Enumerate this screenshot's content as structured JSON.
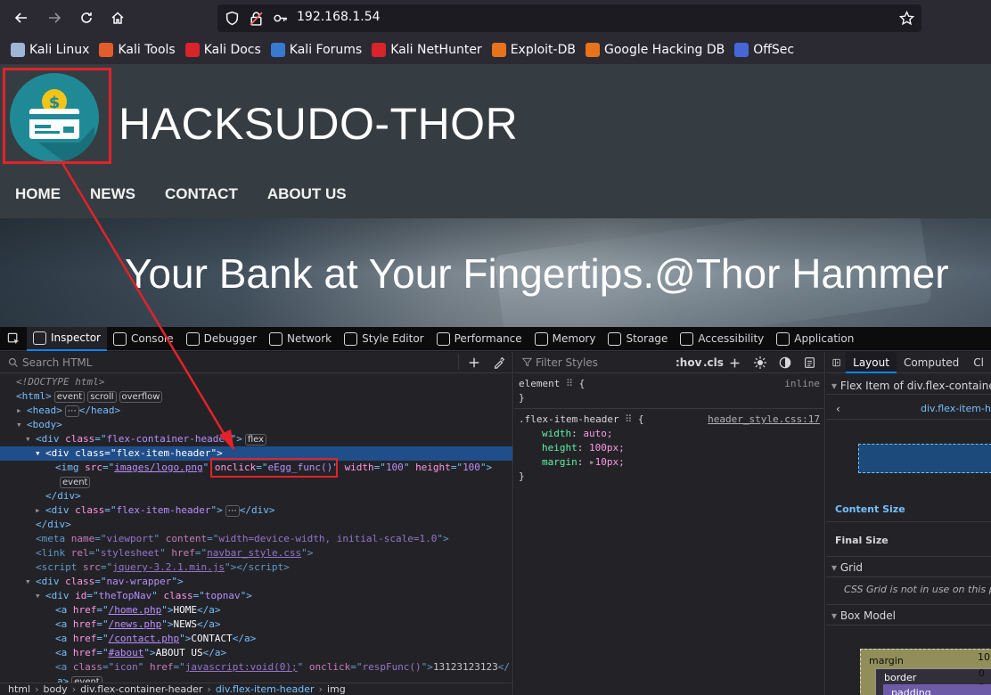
{
  "browser": {
    "url": "192.168.1.54",
    "bookmarks": [
      {
        "label": "Kali Linux",
        "color": "#9fb7d6"
      },
      {
        "label": "Kali Tools",
        "color": "#e35d2b"
      },
      {
        "label": "Kali Docs",
        "color": "#d9242b"
      },
      {
        "label": "Kali Forums",
        "color": "#367bd1"
      },
      {
        "label": "Kali NetHunter",
        "color": "#d9242b"
      },
      {
        "label": "Exploit-DB",
        "color": "#e8731a"
      },
      {
        "label": "Google Hacking DB",
        "color": "#e8731a"
      },
      {
        "label": "OffSec",
        "color": "#4767d9"
      }
    ]
  },
  "site": {
    "title": "HACKSUDO-THOR",
    "nav": [
      "HOME",
      "NEWS",
      "CONTACT",
      "ABOUT US"
    ],
    "hero_text": "Your Bank at Your Fingertips.@Thor Hammer"
  },
  "devtools": {
    "tabs": [
      "Inspector",
      "Console",
      "Debugger",
      "Network",
      "Style Editor",
      "Performance",
      "Memory",
      "Storage",
      "Accessibility",
      "Application"
    ],
    "search_placeholder": "Search HTML",
    "filter_placeholder": "Filter Styles",
    "hov": ":hov",
    "cls": ".cls",
    "html_tree": {
      "doctype": "<!DOCTYPE html>",
      "badges": [
        "event",
        "scroll",
        "overflow"
      ],
      "flex_badge": "flex",
      "event_badge": "event",
      "img_src": "images/logo.png",
      "onclick": "eEgg_func()",
      "width": "100",
      "height": "100",
      "viewport": "width=device-width, initial-scale=1.0",
      "stylesheet": "navbar_style.css",
      "script_src": "jquery-3.2.1.min.js",
      "nav_id": "theTopNav",
      "links": [
        {
          "href": "/home.php",
          "text": "HOME"
        },
        {
          "href": "/news.php",
          "text": "NEWS"
        },
        {
          "href": "/contact.php",
          "text": "CONTACT"
        },
        {
          "href": "#about",
          "text": "ABOUT US"
        }
      ],
      "icon_onclick": "respFunc()",
      "icon_text": "13123123123"
    },
    "breadcrumbs": [
      "html",
      "body",
      "div.flex-container-header",
      "div.flex-item-header",
      "img"
    ],
    "rules": {
      "element_label": "element",
      "inline": "inline",
      "selector": ".flex-item-header",
      "source": "header_style.css:17",
      "props": [
        {
          "name": "width",
          "value": "auto;"
        },
        {
          "name": "height",
          "value": "100px;"
        },
        {
          "name": "margin",
          "value": "10px;"
        }
      ]
    },
    "layout": {
      "tabs": [
        "Layout",
        "Computed",
        "Cl"
      ],
      "flex_item": "Flex Item of div.flex-container-h",
      "node": "div.flex-item-h",
      "content_size": "Content Size",
      "final_size": "Final Size",
      "grid": "Grid",
      "grid_note": "CSS Grid is not in use on this pa",
      "box_model": "Box Model",
      "margin": "margin",
      "border": "border",
      "padding": "padding",
      "margin_val": "10",
      "zero": "0"
    }
  }
}
